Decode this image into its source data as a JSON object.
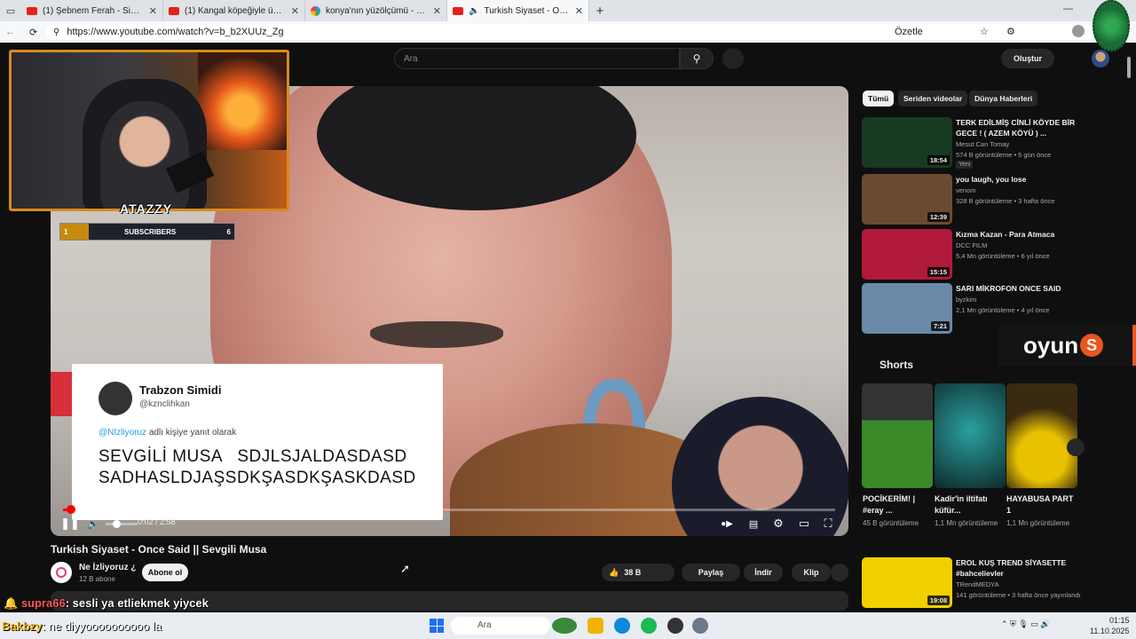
{
  "browser": {
    "tabs": [
      {
        "title": "(1) Şebnem Ferah - Sigara (Officia",
        "icon": "youtube-icon"
      },
      {
        "title": "(1) Kangal köpeğiyle ünlü Sivas'ın",
        "icon": "youtube-icon"
      },
      {
        "title": "konya'nın yüzölçümü - Google'da",
        "icon": "google-icon"
      },
      {
        "title": "Turkish Siyaset - Once Said ||",
        "icon": "youtube-icon"
      }
    ],
    "url": "https://www.youtube.com/watch?v=b_b2XUUz_Zg",
    "summarize_label": "Özetle"
  },
  "youtube": {
    "search_placeholder": "Ara",
    "create_label": "Oluştur",
    "video": {
      "title": "Turkish Siyaset - Once Said || Sevgili Musa",
      "time": "0:02 / 2:58",
      "progress_fraction": 0.01,
      "channel": "Ne İzliyoruz ¿",
      "channel_subs": "12 B abone",
      "subscribe_label": "Abone ol",
      "likes": "38 B",
      "share_label": "Paylaş",
      "download_label": "İndir",
      "clip_label": "Klip"
    },
    "tweet": {
      "name": "Trabzon Simidi",
      "handle": "@kznclihkan",
      "reply_to": "@NIzliyoruz",
      "reply_suffix": " adlı kişiye yanıt olarak",
      "line1": "SEVGİLİ MUSA   SDJLSJALDASDASD",
      "line2": "SADHASLDJAŞSDKŞASDKŞASKDASD"
    },
    "chips": [
      "Tümü",
      "Seriden videolar",
      "Dünya Haberleri"
    ],
    "recommendations": [
      {
        "title": "TERK EDİLMİŞ CİNLİ KÖYDE BİR GECE ! ( AZEM KÖYÜ ) ...",
        "channel": "Mesut Can Tomay",
        "meta": "574 B görüntüleme • 5 gün önce",
        "duration": "18:54",
        "badge": "Yeni",
        "thumb": "#173a21"
      },
      {
        "title": "you laugh, you lose",
        "channel": "venom",
        "meta": "328 B görüntüleme • 3 hafta önce",
        "duration": "12:39",
        "badge": "",
        "thumb": "#6b4a33"
      },
      {
        "title": "Kızma Kazan - Para Atmaca",
        "channel": "DCC FILM",
        "meta": "5,4 Mn görüntüleme • 6 yıl önce",
        "duration": "15:15",
        "badge": "",
        "thumb": "#b11a3a"
      },
      {
        "title": "SARI MİKROFON ONCE SAID",
        "channel": "byzkim",
        "meta": "2,1 Mn görüntüleme • 4 yıl önce",
        "duration": "7:21",
        "badge": "",
        "thumb": "#6a8aa8"
      },
      {
        "title": "EROL KUŞ TREND SİYASETTE #bahcelievler",
        "channel": "TRendMEDYA",
        "meta": "141 görüntüleme • 3 hafta önce yayınlandı",
        "duration": "19:08",
        "badge": "",
        "thumb": "#f1d000"
      }
    ],
    "shorts_heading": "Shorts",
    "shorts": [
      {
        "title": "POCİKERİM! | #eray ...",
        "views": "45 B görüntüleme",
        "thumb": "#3a8a2a"
      },
      {
        "title": "Kadir'in iltifatı küfür...",
        "views": "1,1 Mn görüntüleme",
        "thumb": "#1f6a6a"
      },
      {
        "title": "HAYABUSA PART 1",
        "views": "1,1 Mn görüntüleme",
        "thumb": "#7a5a1a"
      }
    ]
  },
  "overlay": {
    "brand": "ATAZZY",
    "subs_left": "1",
    "subs_label": "SUBSCRIBERS",
    "subs_right": "6",
    "sponsor": "oyun",
    "sponsor_badge": "S",
    "chat": [
      {
        "user": "supra66",
        "text": ": sesli ya etliekmek yiycek"
      },
      {
        "user": "Bakbzy",
        "text": ": ne diyyoooooooooo la"
      }
    ]
  },
  "taskbar": {
    "search_placeholder": "Ara",
    "time": "01:15",
    "date": "11.10.2025"
  },
  "colors": {
    "yt_red": "#ff0000",
    "bg": "#0f0f0f",
    "cam_border": "#d88a1c",
    "sponsor": "#e9551f"
  }
}
